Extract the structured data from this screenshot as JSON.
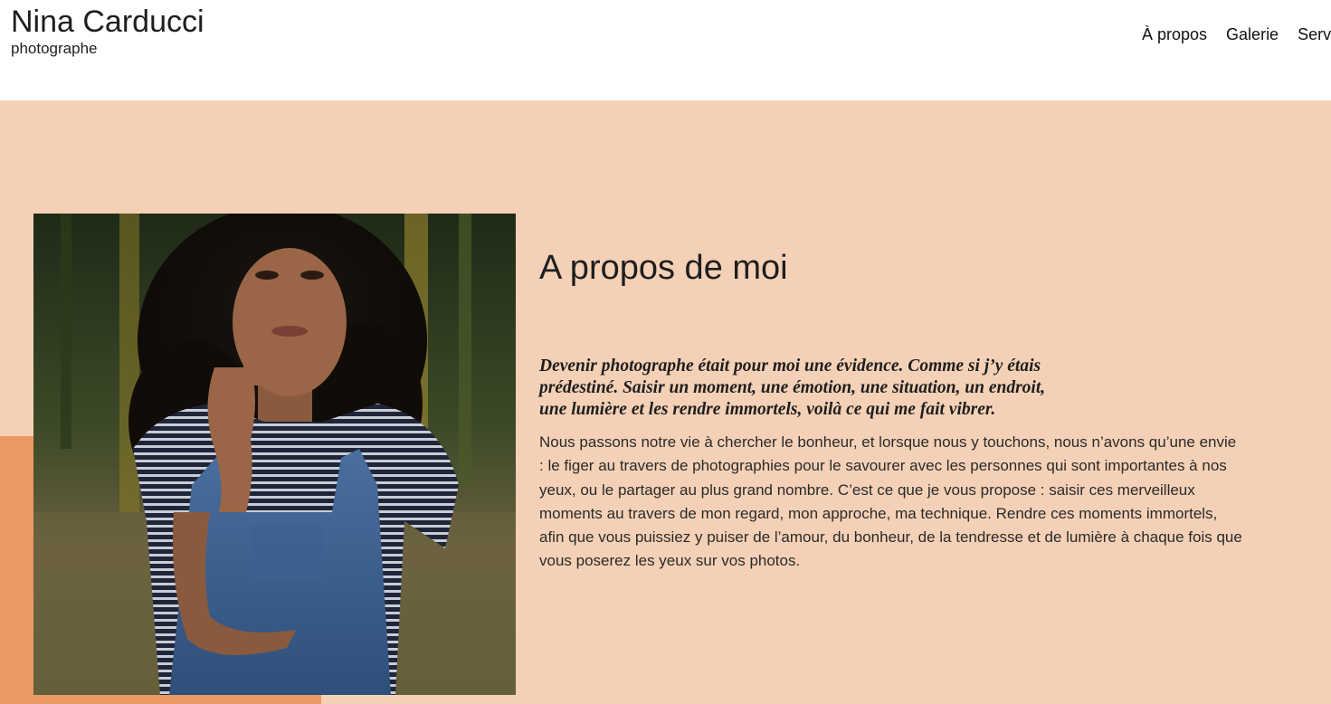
{
  "header": {
    "brand_name": "Nina Carducci",
    "tagline": "photographe",
    "nav": [
      {
        "label": "À propos"
      },
      {
        "label": "Galerie"
      },
      {
        "label": "Services"
      }
    ]
  },
  "about": {
    "title": "A propos de moi",
    "photo_alt": "Portrait d'une femme aux cheveux bouclés portant une salopette en jean",
    "quote_lines": [
      "Devenir photographe était pour moi une évidence. Comme si j’y étais",
      "prédestiné. Saisir un moment, une émotion, une situation, un endroit,",
      "une lumière et les rendre immortels, voilà ce qui me fait vibrer."
    ],
    "body_lines": [
      "Nous passons notre vie à chercher le bonheur, et lorsque nous y touchons, nous n’avons qu’une envie",
      ": le figer au travers de photographies pour le savourer avec les personnes qui sont importantes à nos",
      "yeux, ou le partager au plus grand nombre. C’est ce que je vous propose : saisir ces merveilleux",
      "moments au travers de mon regard, mon approche, ma technique. Rendre ces moments immortels,",
      "afin que vous puissiez y puiser de l’amour, du bonheur, de la tendresse et de lumière à chaque fois que",
      "vous poserez les yeux sur vos photos."
    ]
  },
  "colors": {
    "section_background": "#f4d1b6",
    "accent_block": "#e99a62",
    "text": "#1e1e1e"
  }
}
